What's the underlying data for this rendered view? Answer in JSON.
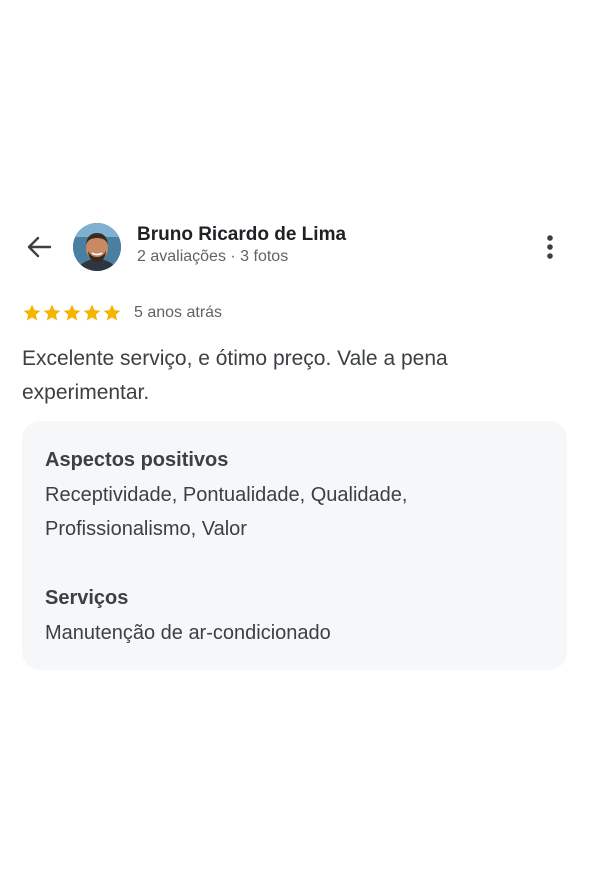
{
  "header": {
    "back_icon": "arrow-left-icon",
    "author_name": "Bruno Ricardo de Lima",
    "author_meta": "2 avaliações · 3 fotos",
    "more_icon": "more-vertical-icon"
  },
  "rating": {
    "stars": 5,
    "star_color": "#f4b400",
    "time": "5 anos atrás"
  },
  "review": {
    "text": "Excelente serviço, e ótimo preço. Vale a pena experimentar."
  },
  "aspects": {
    "positive_title": "Aspectos positivos",
    "positive_value": "Receptividade, Pontualidade, Qualidade, Profissionalismo, Valor",
    "services_title": "Serviços",
    "services_value": "Manutenção de ar-condicionado"
  },
  "colors": {
    "card_background": "#f6f7f9",
    "text_primary": "#202124",
    "text_secondary": "#5f6368"
  }
}
